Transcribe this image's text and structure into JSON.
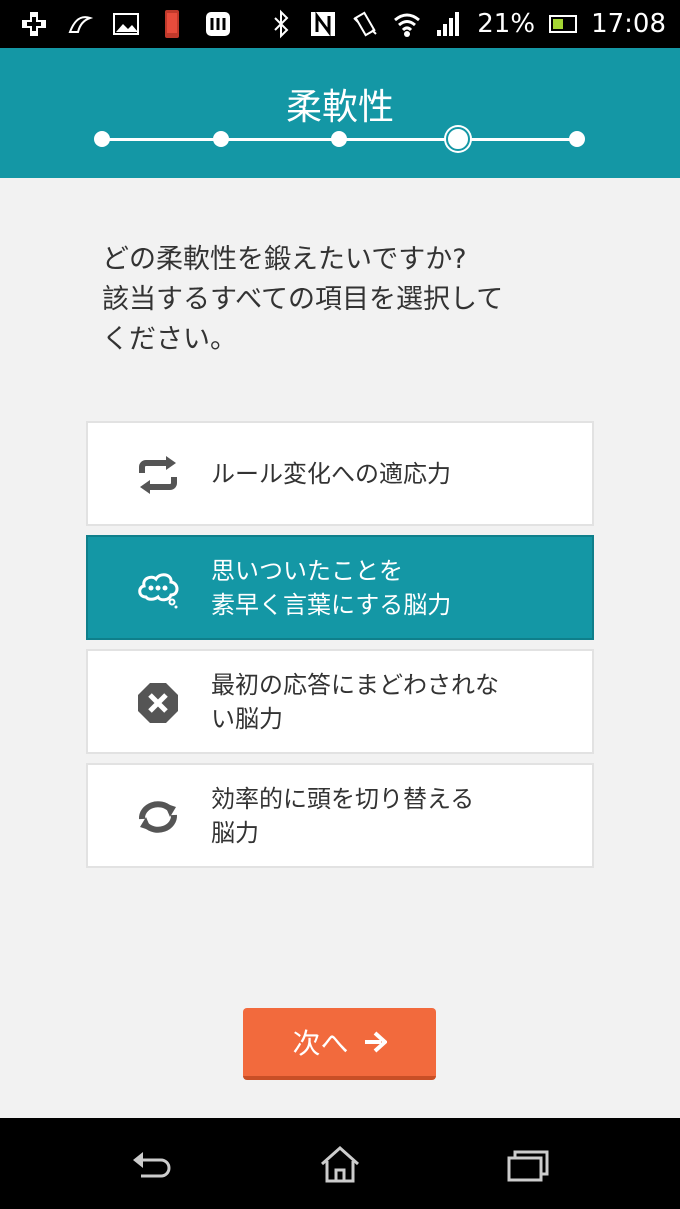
{
  "status_bar": {
    "battery_percent": "21%",
    "time": "17:08"
  },
  "header": {
    "title": "柔軟性",
    "progress": {
      "steps": 5,
      "current_step": 4
    }
  },
  "question": {
    "lines": [
      "どの柔軟性を鍛えたいですか?",
      "該当するすべての項目を選択して",
      "ください。"
    ]
  },
  "options": [
    {
      "lines": [
        "ルール変化への適応力"
      ],
      "icon": "repeat-icon",
      "selected": false
    },
    {
      "lines": [
        "思いついたことを",
        "素早く言葉にする脳力"
      ],
      "icon": "thought-bubble-icon",
      "selected": true
    },
    {
      "lines": [
        "最初の応答にまどわされな",
        "い脳力"
      ],
      "icon": "close-octagon-icon",
      "selected": false
    },
    {
      "lines": [
        "効率的に頭を切り替える",
        "脳力"
      ],
      "icon": "switch-arrows-icon",
      "selected": false
    }
  ],
  "next_button": {
    "label": "次へ",
    "icon": "arrow-right-icon"
  },
  "nav_bar": {
    "icons": [
      "back-icon",
      "home-icon",
      "recent-apps-icon"
    ]
  },
  "colors": {
    "accent": "#1497a5",
    "button": "#f26a3d",
    "background": "#f2f2f2"
  }
}
